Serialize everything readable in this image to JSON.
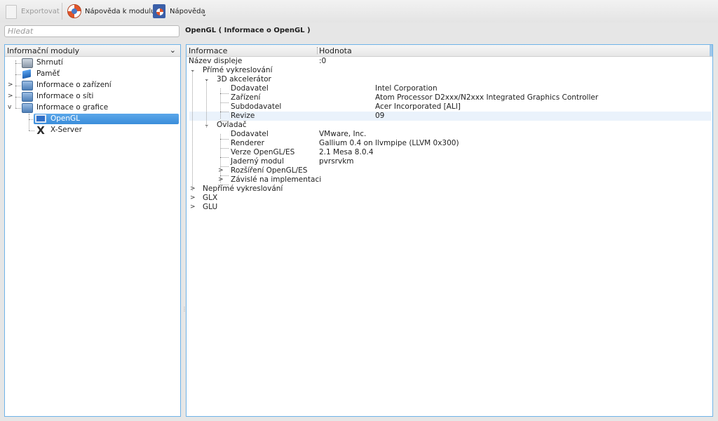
{
  "toolbar": {
    "export_label": "Exportovat",
    "module_help_label": "Nápověda k modulu",
    "help_label": "Nápověda"
  },
  "search": {
    "placeholder": "Hledat"
  },
  "module_title": "OpenGL  ( Informace o OpenGL )",
  "left_panel": {
    "header": "Informační moduly",
    "items": [
      {
        "label": "Shrnutí",
        "icon": "summary-icon"
      },
      {
        "label": "Paměť",
        "icon": "memory-icon"
      },
      {
        "label": "Informace o zařízení",
        "icon": "folder-icon",
        "expander": ">"
      },
      {
        "label": "Informace o síti",
        "icon": "folder-icon",
        "expander": ">"
      },
      {
        "label": "Informace o grafice",
        "icon": "folder-icon",
        "expander": "v"
      },
      {
        "label": "OpenGL",
        "icon": "monitor-icon",
        "selected": true
      },
      {
        "label": "X-Server",
        "icon": "x-icon"
      }
    ]
  },
  "right_panel": {
    "col_info": "Informace",
    "col_value": "Hodnota",
    "rows": [
      {
        "label": "Název displeje",
        "value": ":0"
      },
      {
        "label": "Přímé vykreslování",
        "value": ""
      },
      {
        "label": "3D akcelerátor",
        "value": ""
      },
      {
        "label": "Dodavatel",
        "value": "Intel Corporation"
      },
      {
        "label": "Zařízení",
        "value": "Atom Processor D2xxx/N2xxx Integrated Graphics Controller"
      },
      {
        "label": "Subdodavatel",
        "value": "Acer Incorporated [ALI]"
      },
      {
        "label": "Revize",
        "value": "09"
      },
      {
        "label": "Ovladač",
        "value": ""
      },
      {
        "label": "Dodavatel",
        "value": "VMware, Inc."
      },
      {
        "label": "Renderer",
        "value": "Gallium 0.4 on llvmpipe (LLVM 0x300)"
      },
      {
        "label": "Verze OpenGL/ES",
        "value": "2.1 Mesa 8.0.4"
      },
      {
        "label": "Jaderný modul",
        "value": "pvrsrvkm"
      },
      {
        "label": "Rozšíření OpenGL/ES",
        "value": ""
      },
      {
        "label": "Závislé na implementaci",
        "value": ""
      },
      {
        "label": "Nepřímé vykreslování",
        "value": ""
      },
      {
        "label": "GLX",
        "value": ""
      },
      {
        "label": "GLU",
        "value": ""
      }
    ]
  }
}
